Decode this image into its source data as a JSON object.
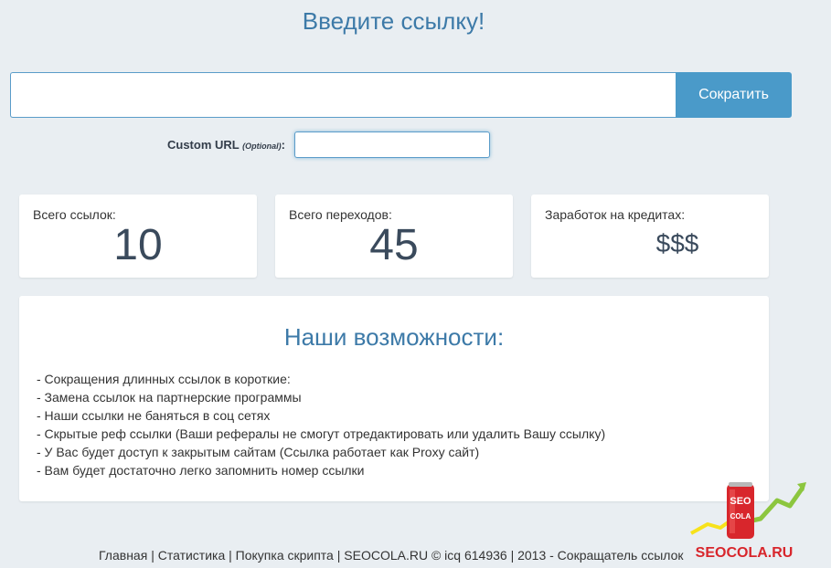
{
  "title": "Введите ссылку!",
  "url_form": {
    "input_value": "",
    "submit_label": "Сократить"
  },
  "custom_url": {
    "label": "Custom URL",
    "optional": "(Optional)",
    "colon": ":",
    "value": ""
  },
  "stats": [
    {
      "label": "Всего ссылок:",
      "value": "10"
    },
    {
      "label": "Всего переходов:",
      "value": "45"
    },
    {
      "label": "Заработок на кредитах:",
      "value": "$$$"
    }
  ],
  "features": {
    "heading": "Наши возможности:",
    "items": [
      "- Сокращения длинных ссылок в короткие:",
      "- Замена ссылок на партнерские программы",
      "- Наши ссылки не баняться в соц сетях",
      "- Скрытые реф ссылки (Ваши рефералы не смогут отредактировать или удалить Вашу ссылку)",
      "- У Вас будет доступ к закрытым сайтам (Ссылка работает как Proxy сайт)",
      "- Вам будет достаточно легко запомнить номер ссылки"
    ]
  },
  "footer": {
    "links": [
      "Главная",
      "Статистика",
      "Покупка скрипта"
    ],
    "separator": "|",
    "credits": "SEOCOLA.RU © icq 614936 | 2013 - Сокращатель ссылок"
  },
  "logo": {
    "can_text_1": "SEO",
    "can_text_2": "COLA",
    "brand": "SEOCOLA.RU",
    "colors": {
      "red": "#d8262c",
      "green": "#8cc63f",
      "yellow": "#f7e21b"
    }
  },
  "colors": {
    "accent": "#4a9ac9",
    "heading": "#3d7aa8",
    "background": "#e9eef2"
  }
}
